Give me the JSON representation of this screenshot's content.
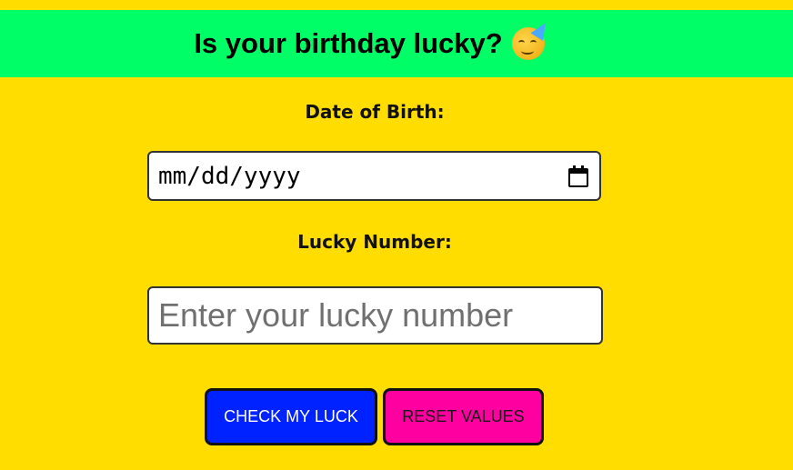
{
  "header": {
    "title": "Is your birthday lucky?",
    "emoji_icon": "partying-face-icon",
    "background": "#00ff66"
  },
  "page": {
    "background": "#ffdd00"
  },
  "form": {
    "dob_label": "Date of Birth:",
    "dob_value": "mm/dd/yyyy",
    "lucky_label": "Lucky Number:",
    "lucky_placeholder": "Enter your lucky number"
  },
  "buttons": {
    "check_label": "CHECK MY LUCK",
    "check_color": "#0022ff",
    "reset_label": "RESET VALUES",
    "reset_color": "#ff00a0"
  }
}
